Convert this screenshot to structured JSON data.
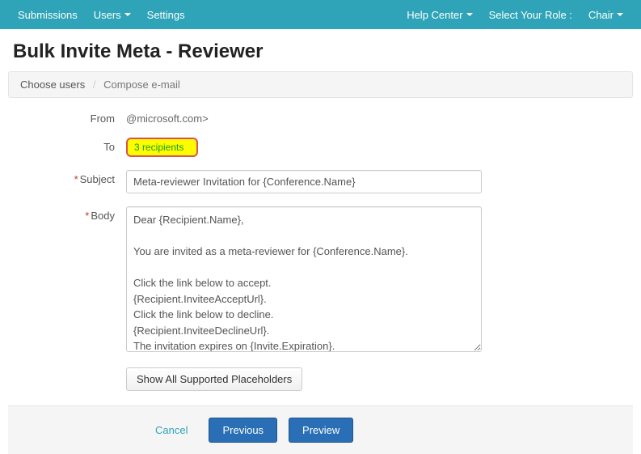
{
  "nav": {
    "submissions": "Submissions",
    "users": "Users",
    "settings": "Settings",
    "help_center": "Help Center",
    "role_label": "Select Your Role :",
    "role_value": "Chair"
  },
  "page_title": "Bulk Invite Meta - Reviewer",
  "breadcrumb": {
    "step1": "Choose users",
    "sep": "/",
    "step2": "Compose e-mail"
  },
  "form": {
    "labels": {
      "from": "From",
      "to": "To",
      "subject": "Subject",
      "body": "Body"
    },
    "from_value": "@microsoft.com>",
    "recipients_text": "3 recipients",
    "subject_value": "Meta-reviewer Invitation for {Conference.Name}",
    "body_value": "Dear {Recipient.Name},\n\nYou are invited as a meta-reviewer for {Conference.Name}.\n\nClick the link below to accept.\n{Recipient.InviteeAcceptUrl}.\nClick the link below to decline.\n{Recipient.InviteeDeclineUrl}.\nThe invitation expires on {Invite.Expiration}.\n\nPlease contact {Sender.Email} if you have questions about the invitation."
  },
  "buttons": {
    "show_placeholders": "Show All Supported Placeholders",
    "cancel": "Cancel",
    "previous": "Previous",
    "preview": "Preview"
  }
}
